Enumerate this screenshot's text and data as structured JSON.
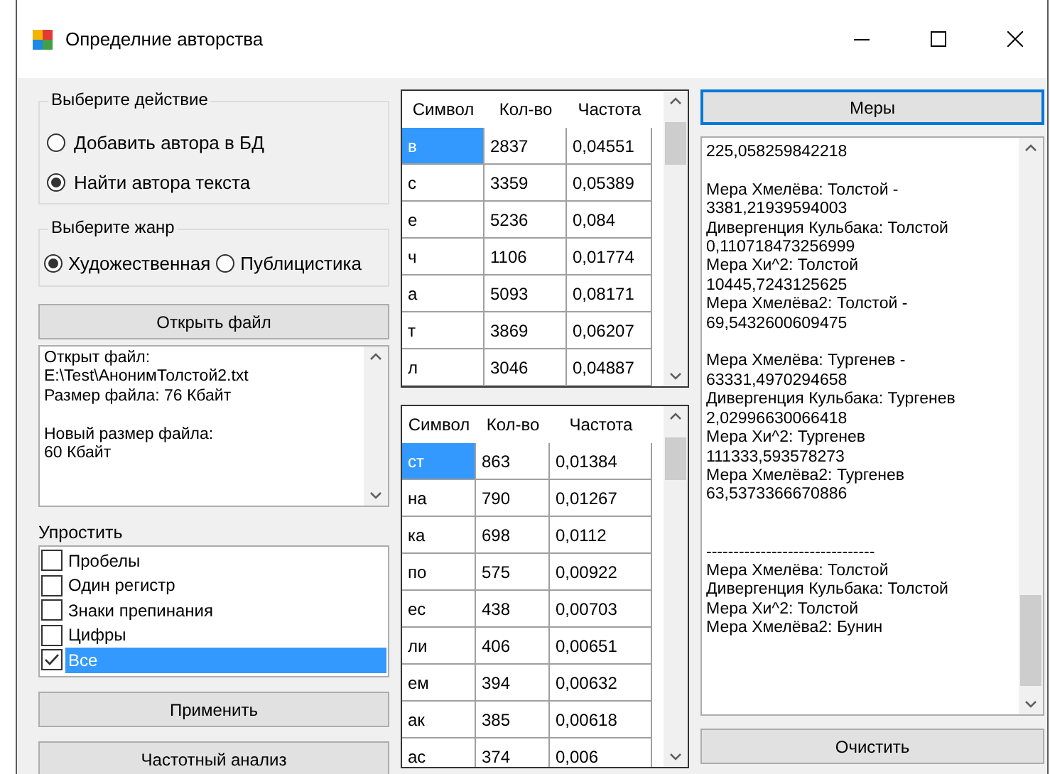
{
  "window": {
    "title": "Определние авторства"
  },
  "action_group": {
    "title": "Выберите действие",
    "options": [
      {
        "label": "Добавить автора в БД",
        "selected": false
      },
      {
        "label": "Найти автора текста",
        "selected": true
      }
    ]
  },
  "genre_group": {
    "title": "Выберите жанр",
    "options": [
      {
        "label": "Художественная",
        "selected": true
      },
      {
        "label": "Публицистика",
        "selected": false
      }
    ]
  },
  "open_button": "Открыть файл",
  "file_info": {
    "value": "Открыт файл:\nE:\\Test\\АнонимТолстой2.txt\nРазмер файла: 76 Кбайт\n\nНовый размер файла:\n60 Кбайт"
  },
  "simplify": {
    "label": "Упростить",
    "items": [
      {
        "label": "Пробелы",
        "checked": false,
        "selected": false
      },
      {
        "label": "Один регистр",
        "checked": false,
        "selected": false
      },
      {
        "label": "Знаки препинания",
        "checked": false,
        "selected": false
      },
      {
        "label": "Цифры",
        "checked": false,
        "selected": false
      },
      {
        "label": "Все",
        "checked": true,
        "selected": true
      }
    ]
  },
  "apply_button": "Применить",
  "freq_button": "Частотный анализ",
  "letters_table": {
    "columns": [
      "Символ",
      "Кол-во",
      "Частота"
    ],
    "rows": [
      {
        "cells": [
          "в",
          "2837",
          "0,04551"
        ],
        "selected": true
      },
      {
        "cells": [
          "с",
          "3359",
          "0,05389"
        ],
        "selected": false
      },
      {
        "cells": [
          "е",
          "5236",
          "0,084"
        ],
        "selected": false
      },
      {
        "cells": [
          "ч",
          "1106",
          "0,01774"
        ],
        "selected": false
      },
      {
        "cells": [
          "а",
          "5093",
          "0,08171"
        ],
        "selected": false
      },
      {
        "cells": [
          "т",
          "3869",
          "0,06207"
        ],
        "selected": false
      },
      {
        "cells": [
          "л",
          "3046",
          "0,04887"
        ],
        "selected": false
      }
    ]
  },
  "bigrams_table": {
    "columns": [
      "Символ",
      "Кол-во",
      "Частота"
    ],
    "rows": [
      {
        "cells": [
          "ст",
          "863",
          "0,01384"
        ],
        "selected": true
      },
      {
        "cells": [
          "на",
          "790",
          "0,01267"
        ],
        "selected": false
      },
      {
        "cells": [
          "ка",
          "698",
          "0,0112"
        ],
        "selected": false
      },
      {
        "cells": [
          "по",
          "575",
          "0,00922"
        ],
        "selected": false
      },
      {
        "cells": [
          "ес",
          "438",
          "0,00703"
        ],
        "selected": false
      },
      {
        "cells": [
          "ли",
          "406",
          "0,00651"
        ],
        "selected": false
      },
      {
        "cells": [
          "ем",
          "394",
          "0,00632"
        ],
        "selected": false
      },
      {
        "cells": [
          "ак",
          "385",
          "0,00618"
        ],
        "selected": false
      },
      {
        "cells": [
          "ас",
          "374",
          "0,006"
        ],
        "selected": false
      }
    ]
  },
  "measures_button": "Меры",
  "results": {
    "value": "225,058259842218\n\nМера Хмелёва: Толстой -\n3381,21939594003\nДивергенция Кульбака: Толстой\n0,110718473256999\nМера Хи^2: Толстой\n10445,7243125625\nМера Хмелёва2: Толстой -\n69,5432600609475\n\nМера Хмелёва: Тургенев -\n63331,4970294658\nДивергенция Кульбака: Тургенев\n2,02996630066418\nМера Хи^2: Тургенев\n111333,593578273\nМера Хмелёва2: Тургенев\n63,5373366670886\n\n\n-------------------------------\nМера Хмелёва: Толстой\nДивергенция Кульбака: Толстой\nМера Хи^2: Толстой\nМера Хмелёва2: Бунин"
  },
  "clear_button": "Очистить"
}
